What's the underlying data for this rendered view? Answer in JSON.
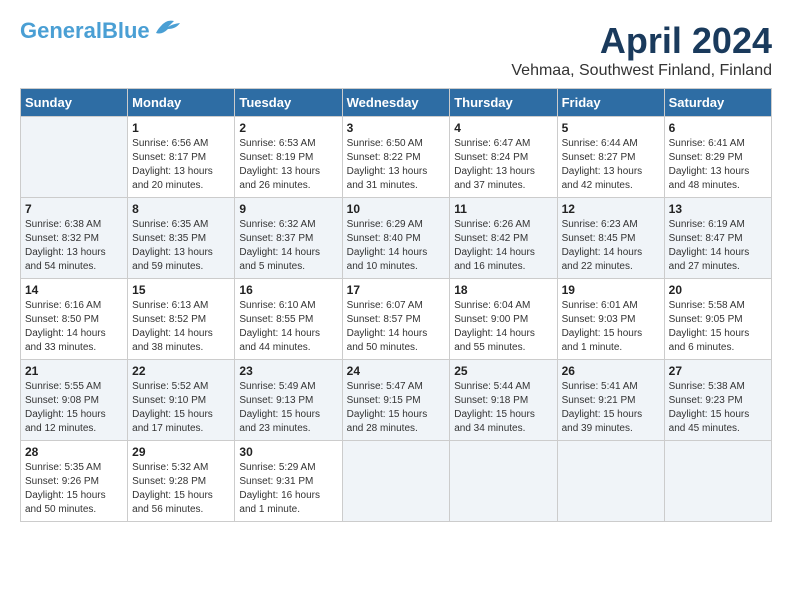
{
  "header": {
    "logo_line1": "General",
    "logo_line2": "Blue",
    "month_title": "April 2024",
    "location": "Vehmaa, Southwest Finland, Finland"
  },
  "weekdays": [
    "Sunday",
    "Monday",
    "Tuesday",
    "Wednesday",
    "Thursday",
    "Friday",
    "Saturday"
  ],
  "weeks": [
    [
      {
        "day": "",
        "info": ""
      },
      {
        "day": "1",
        "info": "Sunrise: 6:56 AM\nSunset: 8:17 PM\nDaylight: 13 hours\nand 20 minutes."
      },
      {
        "day": "2",
        "info": "Sunrise: 6:53 AM\nSunset: 8:19 PM\nDaylight: 13 hours\nand 26 minutes."
      },
      {
        "day": "3",
        "info": "Sunrise: 6:50 AM\nSunset: 8:22 PM\nDaylight: 13 hours\nand 31 minutes."
      },
      {
        "day": "4",
        "info": "Sunrise: 6:47 AM\nSunset: 8:24 PM\nDaylight: 13 hours\nand 37 minutes."
      },
      {
        "day": "5",
        "info": "Sunrise: 6:44 AM\nSunset: 8:27 PM\nDaylight: 13 hours\nand 42 minutes."
      },
      {
        "day": "6",
        "info": "Sunrise: 6:41 AM\nSunset: 8:29 PM\nDaylight: 13 hours\nand 48 minutes."
      }
    ],
    [
      {
        "day": "7",
        "info": "Sunrise: 6:38 AM\nSunset: 8:32 PM\nDaylight: 13 hours\nand 54 minutes."
      },
      {
        "day": "8",
        "info": "Sunrise: 6:35 AM\nSunset: 8:35 PM\nDaylight: 13 hours\nand 59 minutes."
      },
      {
        "day": "9",
        "info": "Sunrise: 6:32 AM\nSunset: 8:37 PM\nDaylight: 14 hours\nand 5 minutes."
      },
      {
        "day": "10",
        "info": "Sunrise: 6:29 AM\nSunset: 8:40 PM\nDaylight: 14 hours\nand 10 minutes."
      },
      {
        "day": "11",
        "info": "Sunrise: 6:26 AM\nSunset: 8:42 PM\nDaylight: 14 hours\nand 16 minutes."
      },
      {
        "day": "12",
        "info": "Sunrise: 6:23 AM\nSunset: 8:45 PM\nDaylight: 14 hours\nand 22 minutes."
      },
      {
        "day": "13",
        "info": "Sunrise: 6:19 AM\nSunset: 8:47 PM\nDaylight: 14 hours\nand 27 minutes."
      }
    ],
    [
      {
        "day": "14",
        "info": "Sunrise: 6:16 AM\nSunset: 8:50 PM\nDaylight: 14 hours\nand 33 minutes."
      },
      {
        "day": "15",
        "info": "Sunrise: 6:13 AM\nSunset: 8:52 PM\nDaylight: 14 hours\nand 38 minutes."
      },
      {
        "day": "16",
        "info": "Sunrise: 6:10 AM\nSunset: 8:55 PM\nDaylight: 14 hours\nand 44 minutes."
      },
      {
        "day": "17",
        "info": "Sunrise: 6:07 AM\nSunset: 8:57 PM\nDaylight: 14 hours\nand 50 minutes."
      },
      {
        "day": "18",
        "info": "Sunrise: 6:04 AM\nSunset: 9:00 PM\nDaylight: 14 hours\nand 55 minutes."
      },
      {
        "day": "19",
        "info": "Sunrise: 6:01 AM\nSunset: 9:03 PM\nDaylight: 15 hours\nand 1 minute."
      },
      {
        "day": "20",
        "info": "Sunrise: 5:58 AM\nSunset: 9:05 PM\nDaylight: 15 hours\nand 6 minutes."
      }
    ],
    [
      {
        "day": "21",
        "info": "Sunrise: 5:55 AM\nSunset: 9:08 PM\nDaylight: 15 hours\nand 12 minutes."
      },
      {
        "day": "22",
        "info": "Sunrise: 5:52 AM\nSunset: 9:10 PM\nDaylight: 15 hours\nand 17 minutes."
      },
      {
        "day": "23",
        "info": "Sunrise: 5:49 AM\nSunset: 9:13 PM\nDaylight: 15 hours\nand 23 minutes."
      },
      {
        "day": "24",
        "info": "Sunrise: 5:47 AM\nSunset: 9:15 PM\nDaylight: 15 hours\nand 28 minutes."
      },
      {
        "day": "25",
        "info": "Sunrise: 5:44 AM\nSunset: 9:18 PM\nDaylight: 15 hours\nand 34 minutes."
      },
      {
        "day": "26",
        "info": "Sunrise: 5:41 AM\nSunset: 9:21 PM\nDaylight: 15 hours\nand 39 minutes."
      },
      {
        "day": "27",
        "info": "Sunrise: 5:38 AM\nSunset: 9:23 PM\nDaylight: 15 hours\nand 45 minutes."
      }
    ],
    [
      {
        "day": "28",
        "info": "Sunrise: 5:35 AM\nSunset: 9:26 PM\nDaylight: 15 hours\nand 50 minutes."
      },
      {
        "day": "29",
        "info": "Sunrise: 5:32 AM\nSunset: 9:28 PM\nDaylight: 15 hours\nand 56 minutes."
      },
      {
        "day": "30",
        "info": "Sunrise: 5:29 AM\nSunset: 9:31 PM\nDaylight: 16 hours\nand 1 minute."
      },
      {
        "day": "",
        "info": ""
      },
      {
        "day": "",
        "info": ""
      },
      {
        "day": "",
        "info": ""
      },
      {
        "day": "",
        "info": ""
      }
    ]
  ]
}
